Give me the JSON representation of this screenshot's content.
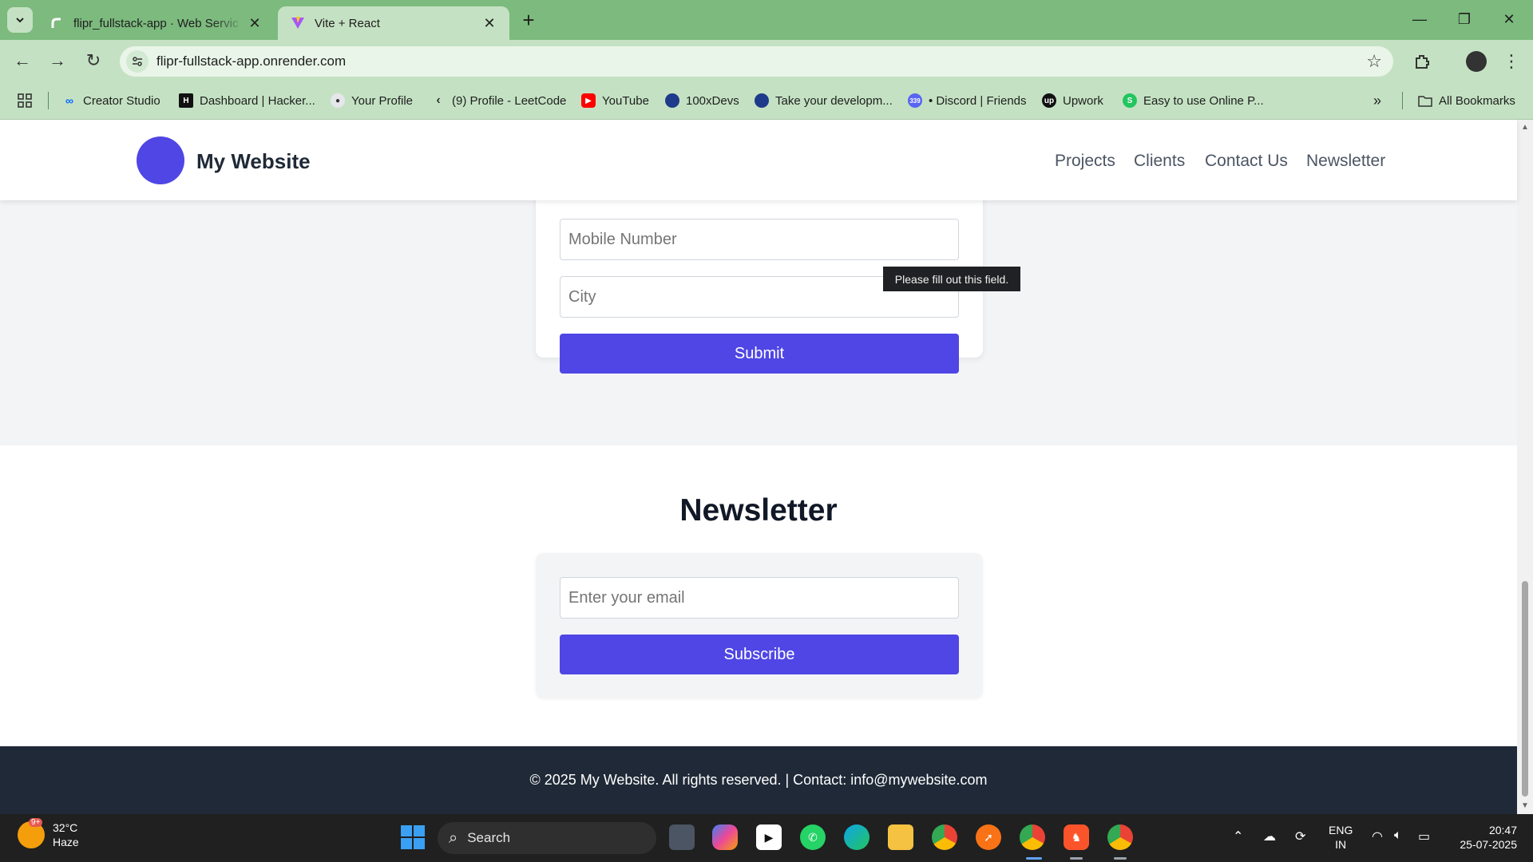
{
  "browser": {
    "tabs": [
      {
        "title": "flipr_fullstack-app · Web Servic",
        "active": false
      },
      {
        "title": "Vite + React",
        "active": true
      }
    ],
    "url": "flipr-fullstack-app.onrender.com",
    "bookmarks": [
      {
        "label": "Creator Studio",
        "icon": "meta-icon",
        "color": "#0866ff"
      },
      {
        "label": "Dashboard | Hacker...",
        "icon": "hackerrank-icon",
        "color": "#111111"
      },
      {
        "label": "Your Profile",
        "icon": "github-icon",
        "color": "#555555"
      },
      {
        "label": "(9) Profile - LeetCode",
        "icon": "leetcode-icon",
        "color": "#f89f1b"
      },
      {
        "label": "YouTube",
        "icon": "youtube-icon",
        "color": "#ff0000"
      },
      {
        "label": "100xDevs",
        "icon": "avatar-icon",
        "color": "#1e3a8a"
      },
      {
        "label": "Take your developm...",
        "icon": "avatar-icon",
        "color": "#1e3a8a"
      },
      {
        "label": "• Discord | Friends",
        "icon": "discord-icon",
        "color": "#5865f2",
        "badge": "339"
      },
      {
        "label": "Upwork",
        "icon": "upwork-icon",
        "color": "#111111"
      },
      {
        "label": "Easy to use Online P...",
        "icon": "s-icon",
        "color": "#22c55e"
      }
    ],
    "all_bookmarks": "All Bookmarks"
  },
  "site": {
    "brand": "My Website",
    "accent": "#4f46e5",
    "nav": [
      "Projects",
      "Clients",
      "Contact Us",
      "Newsletter"
    ]
  },
  "contact_form": {
    "mobile_placeholder": "Mobile Number",
    "city_placeholder": "City",
    "submit_label": "Submit",
    "tooltip": "Please fill out this field."
  },
  "newsletter": {
    "title": "Newsletter",
    "email_placeholder": "Enter your email",
    "subscribe_label": "Subscribe"
  },
  "footer": {
    "text": "© 2025 My Website. All rights reserved. | Contact: info@mywebsite.com"
  },
  "taskbar": {
    "weather_temp": "32°C",
    "weather_desc": "Haze",
    "weather_badge": "9+",
    "search_label": "Search",
    "lang_1": "ENG",
    "lang_2": "IN",
    "time": "20:47",
    "date": "25-07-2025"
  }
}
